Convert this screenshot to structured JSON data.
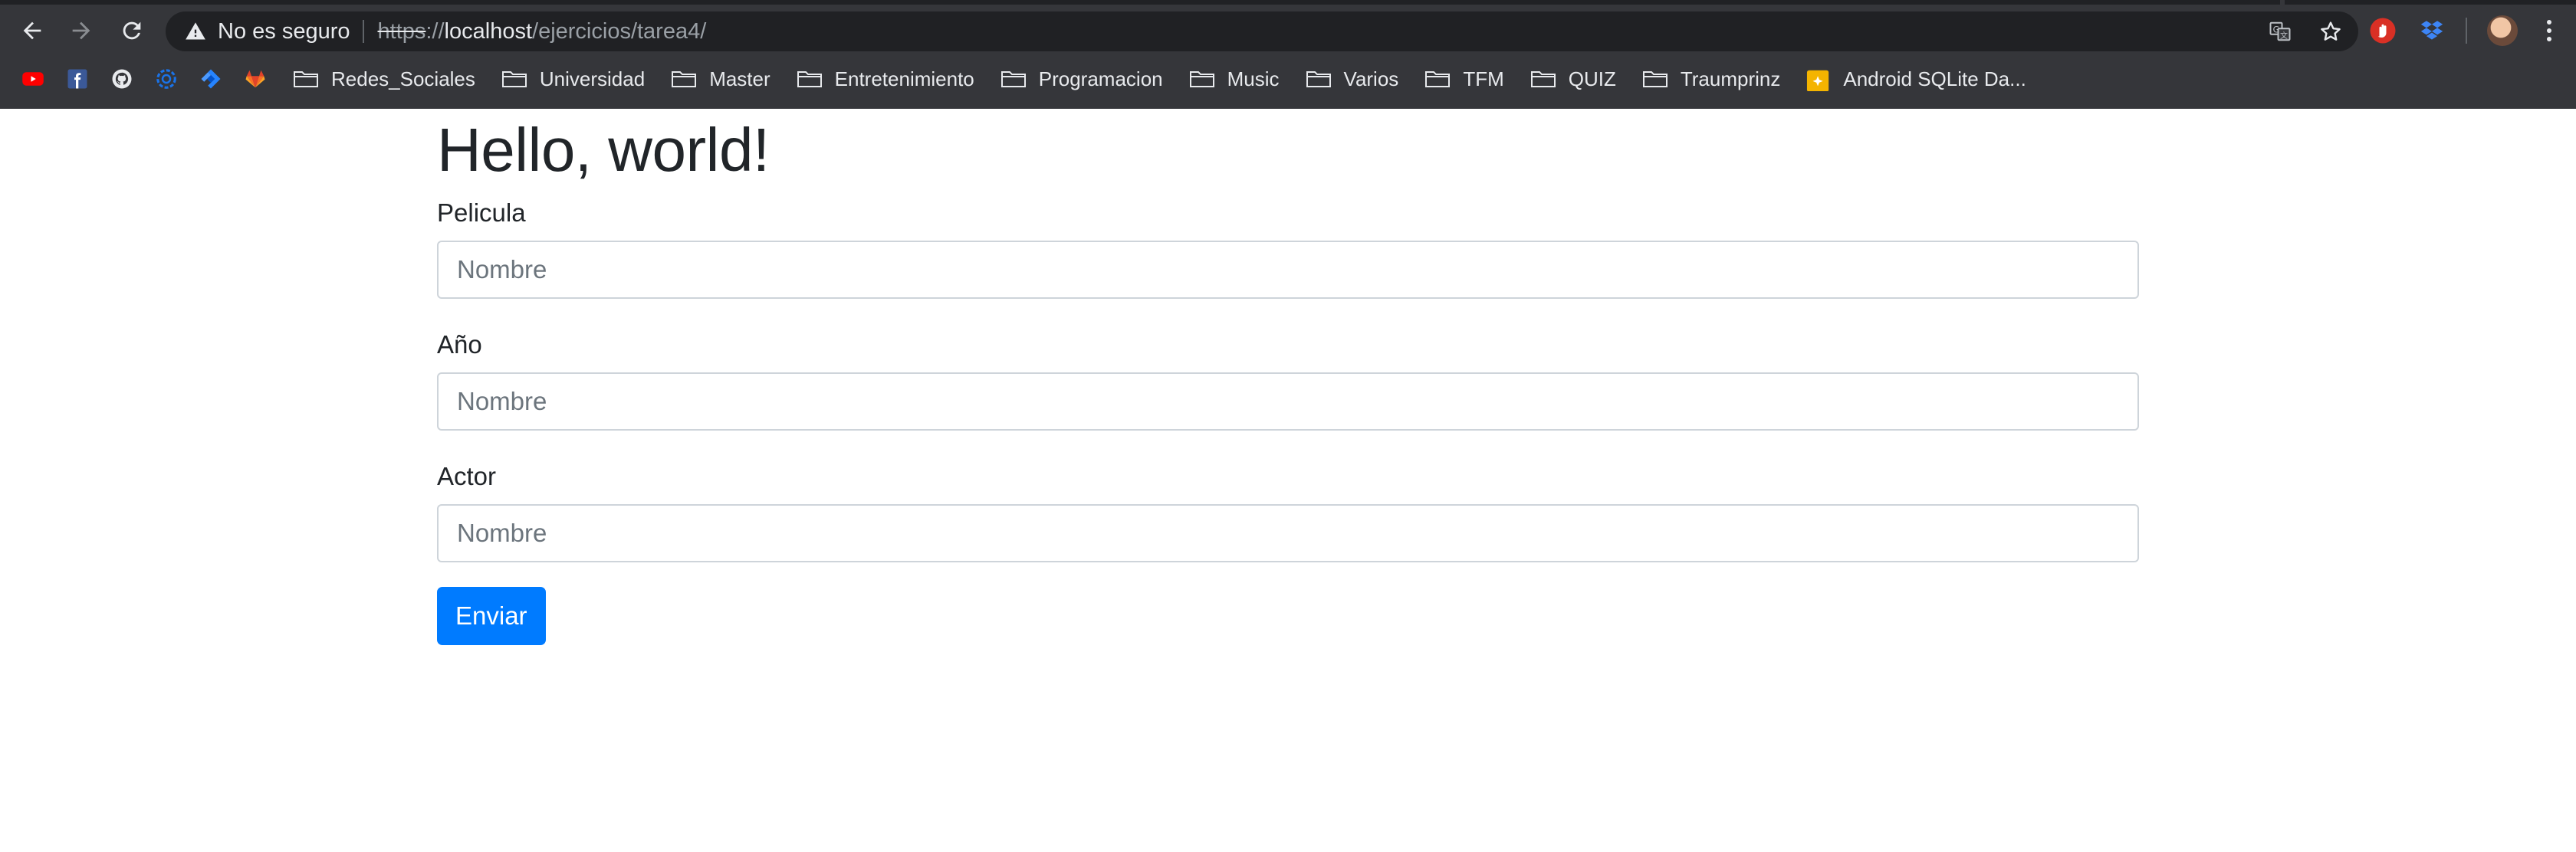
{
  "browser": {
    "security_label": "No es seguro",
    "url": {
      "scheme": "https",
      "separator": "://",
      "host": "localhost",
      "path": "/ejercicios/tarea4/"
    },
    "icons": {
      "back": "arrow-left-icon",
      "forward": "arrow-right-icon",
      "reload": "reload-icon",
      "warning": "warning-triangle-icon",
      "translate": "translate-icon",
      "bookmark": "star-icon",
      "extension_1": "hand-stop-icon",
      "extension_2": "dropbox-icon",
      "menu": "kebab-menu-icon"
    },
    "bookmarks": {
      "icon_items": [
        "youtube-icon",
        "facebook-icon",
        "github-icon",
        "settings-blue-icon",
        "jira-icon",
        "gitlab-icon"
      ],
      "folders": [
        "Redes_Sociales",
        "Universidad",
        "Master",
        "Entretenimiento",
        "Programacion",
        "Music",
        "Varios",
        "TFM",
        "QUIZ",
        "Traumprinz"
      ],
      "last_item": "Android SQLite Da..."
    }
  },
  "page": {
    "title": "Hello, world!",
    "fields": [
      {
        "label": "Pelicula",
        "placeholder": "Nombre"
      },
      {
        "label": "Año",
        "placeholder": "Nombre"
      },
      {
        "label": "Actor",
        "placeholder": "Nombre"
      }
    ],
    "submit_label": "Enviar"
  },
  "colors": {
    "chrome_bg": "#35363a",
    "omnibox_bg": "#202124",
    "primary": "#007bff",
    "text": "#212529",
    "placeholder": "#6c757d",
    "input_border": "#ced4da"
  }
}
